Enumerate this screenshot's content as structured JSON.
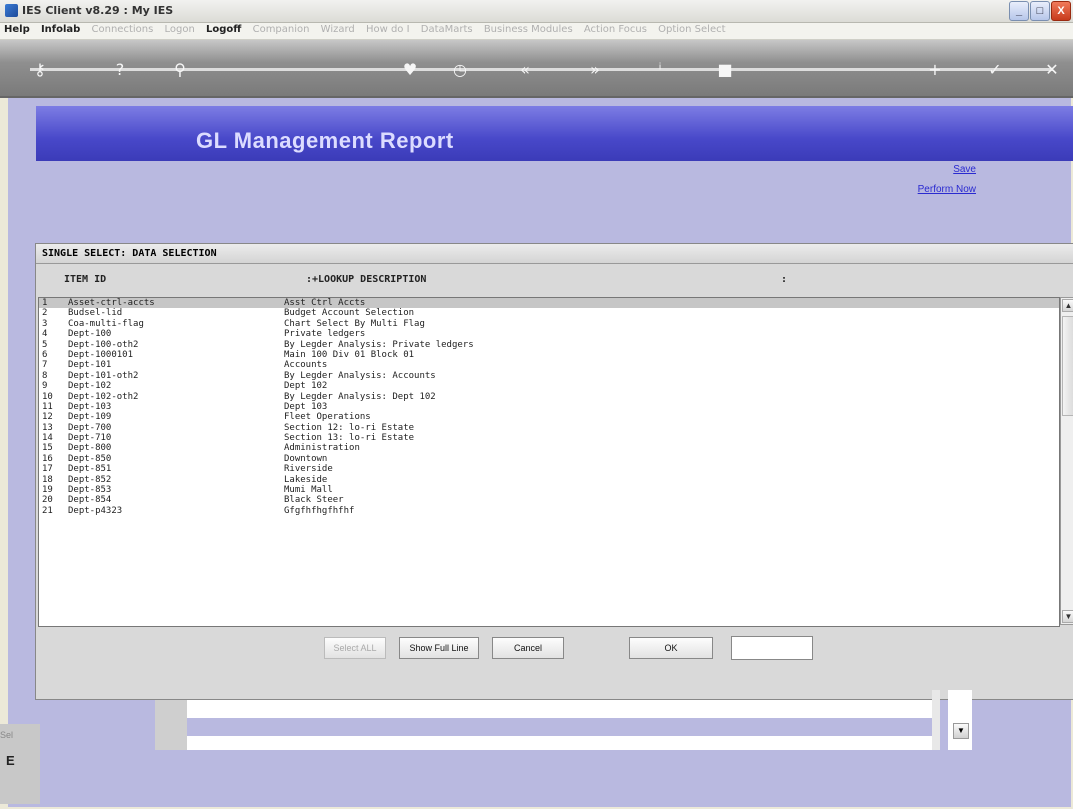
{
  "window": {
    "title": "IES Client v8.29 : My IES",
    "minimize": "_",
    "maximize": "□",
    "close": "X"
  },
  "menu": [
    "Help",
    "Infolab",
    "Connections",
    "Logon",
    "Logoff",
    "Companion",
    "Wizard",
    "How do I",
    "DataMarts",
    "Business Modules",
    "Action Focus",
    "Option Select"
  ],
  "banner": {
    "title": "GL Management Report"
  },
  "links": {
    "save": "Save",
    "perform_now": "Perform Now"
  },
  "dialog": {
    "title": "SINGLE SELECT: DATA SELECTION",
    "headers": {
      "item_id": "ITEM ID",
      "lookup_desc": ":+LOOKUP DESCRIPTION",
      "colon": ":"
    },
    "rows": [
      {
        "n": "1",
        "id": "Asset-ctrl-accts",
        "desc": "Asst Ctrl Accts"
      },
      {
        "n": "2",
        "id": "Budsel-lid",
        "desc": "Budget Account Selection"
      },
      {
        "n": "3",
        "id": "Coa-multi-flag",
        "desc": "Chart Select By Multi Flag"
      },
      {
        "n": "4",
        "id": "Dept-100",
        "desc": "Private ledgers"
      },
      {
        "n": "5",
        "id": "Dept-100-oth2",
        "desc": "By Legder Analysis: Private ledgers"
      },
      {
        "n": "6",
        "id": "Dept-1000101",
        "desc": "Main 100 Div 01 Block 01"
      },
      {
        "n": "7",
        "id": "Dept-101",
        "desc": "Accounts"
      },
      {
        "n": "8",
        "id": "Dept-101-oth2",
        "desc": "By Legder Analysis: Accounts"
      },
      {
        "n": "9",
        "id": "Dept-102",
        "desc": "Dept 102"
      },
      {
        "n": "10",
        "id": "Dept-102-oth2",
        "desc": "By Legder Analysis: Dept 102"
      },
      {
        "n": "11",
        "id": "Dept-103",
        "desc": "Dept 103"
      },
      {
        "n": "12",
        "id": "Dept-109",
        "desc": "Fleet Operations"
      },
      {
        "n": "13",
        "id": "Dept-700",
        "desc": "Section 12: lo-ri Estate"
      },
      {
        "n": "14",
        "id": "Dept-710",
        "desc": "Section 13: lo-ri Estate"
      },
      {
        "n": "15",
        "id": "Dept-800",
        "desc": "Administration"
      },
      {
        "n": "16",
        "id": "Dept-850",
        "desc": "Downtown"
      },
      {
        "n": "17",
        "id": "Dept-851",
        "desc": "Riverside"
      },
      {
        "n": "18",
        "id": "Dept-852",
        "desc": "Lakeside"
      },
      {
        "n": "19",
        "id": "Dept-853",
        "desc": "Mumi Mall"
      },
      {
        "n": "20",
        "id": "Dept-854",
        "desc": "Black Steer"
      },
      {
        "n": "21",
        "id": "Dept-p4323",
        "desc": "Gfgfhfhgfhfhf"
      }
    ],
    "buttons": {
      "select_all": "Select ALL",
      "show_full_line": "Show Full Line",
      "cancel": "Cancel",
      "ok": "OK"
    },
    "ok_field_value": ""
  },
  "lower": {
    "sel_label": "Sel",
    "e_label": "E"
  }
}
